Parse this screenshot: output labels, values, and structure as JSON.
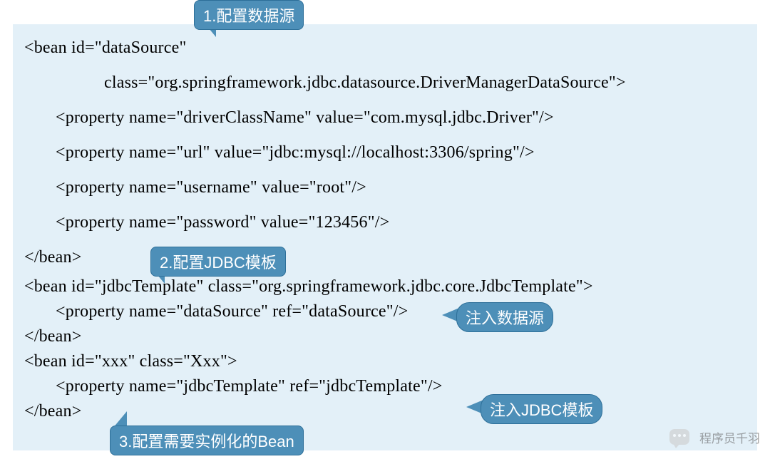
{
  "callouts": {
    "c1": "1.配置数据源",
    "c2": "2.配置JDBC模板",
    "c3": "注入数据源",
    "c4": "注入JDBC模板",
    "c5": "3.配置需要实例化的Bean"
  },
  "code": {
    "l1": "<bean id=\"dataSource\"",
    "l2": "class=\"org.springframework.jdbc.datasource.DriverManagerDataSource\">",
    "l3": "<property name=\"driverClassName\" value=\"com.mysql.jdbc.Driver\"/>",
    "l4": "<property name=\"url\" value=\"jdbc:mysql://localhost:3306/spring\"/>",
    "l5": "<property name=\"username\" value=\"root\"/>",
    "l6": "<property name=\"password\" value=\"123456\"/>",
    "l7": "</bean>",
    "l8": "<bean id=\"jdbcTemplate\" class=\"org.springframework.jdbc.core.JdbcTemplate\">",
    "l9": "<property name=\"dataSource\" ref=\"dataSource\"/>",
    "l10": "</bean>",
    "l11": "<bean id=\"xxx\" class=\"Xxx\">",
    "l12": "<property name=\"jdbcTemplate\" ref=\"jdbcTemplate\"/>",
    "l13": "</bean>"
  },
  "watermark": "程序员千羽"
}
